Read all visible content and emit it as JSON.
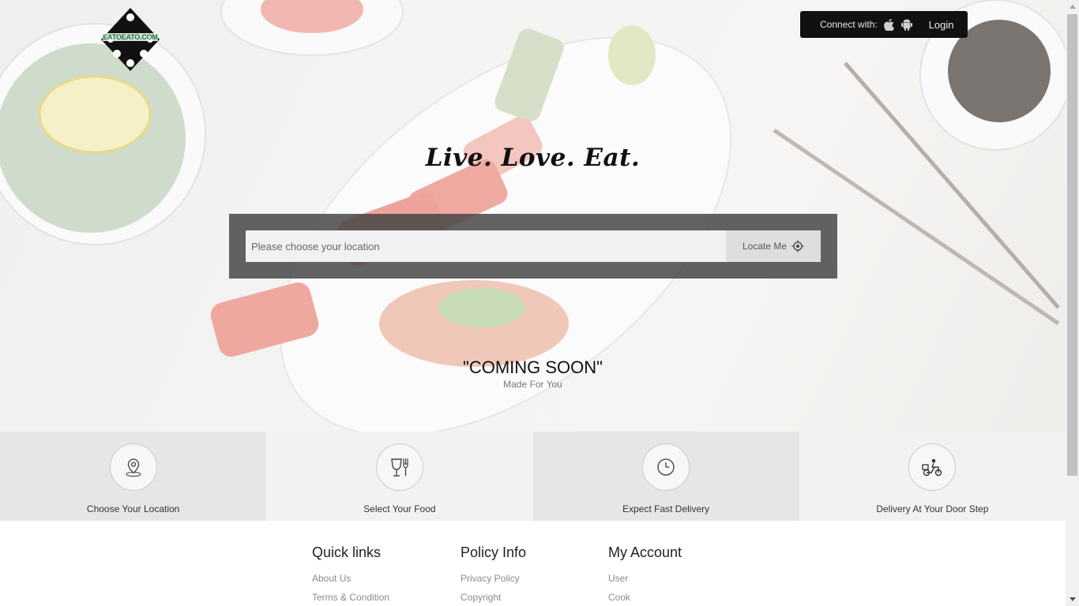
{
  "brand": {
    "logo_text": "EATOEATO.COM"
  },
  "header": {
    "connect_label": "Connect with:",
    "apple_icon": "apple-icon",
    "android_icon": "android-icon",
    "login_label": "Login"
  },
  "hero": {
    "tagline": "Live. Love. Eat.",
    "search": {
      "placeholder": "Please choose your location",
      "value": ""
    },
    "locate_label": "Locate Me",
    "coming_soon": "\"COMING SOON\"",
    "made_for": "Made For You"
  },
  "features": [
    {
      "label": "Choose Your Location",
      "icon": "location-pin-icon"
    },
    {
      "label": "Select Your Food",
      "icon": "cutlery-icon"
    },
    {
      "label": "Expect Fast Delivery",
      "icon": "clock-icon"
    },
    {
      "label": "Delivery At Your Door Step",
      "icon": "delivery-scooter-icon"
    }
  ],
  "footer": {
    "quick_links": {
      "title": "Quick links",
      "links": [
        "About Us",
        "Terms & Condition"
      ]
    },
    "policy_info": {
      "title": "Policy Info",
      "links": [
        "Privacy Policy",
        "Copyright"
      ]
    },
    "my_account": {
      "title": "My Account",
      "links": [
        "User",
        "Cook"
      ]
    }
  },
  "colors": {
    "panel": "#464646",
    "connect_bar": "#111111",
    "feature_dark": "#e6e6e6",
    "feature_light": "#f2f2f2"
  }
}
